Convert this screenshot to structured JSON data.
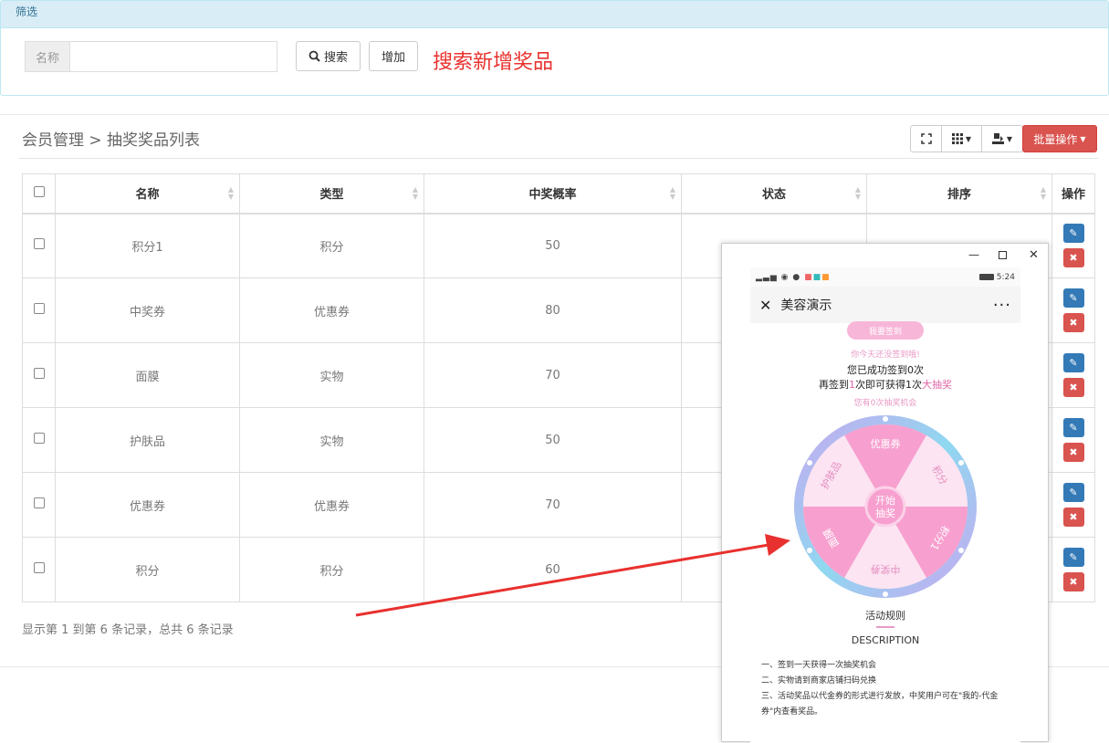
{
  "filter": {
    "header": "筛选",
    "name_label": "名称",
    "name_value": "",
    "search_label": "搜索",
    "add_label": "增加",
    "annotation": "搜索新增奖品"
  },
  "breadcrumb": "会员管理 > 抽奖奖品列表",
  "toolbar": {
    "batch_label": "批量操作"
  },
  "table": {
    "headers": [
      "名称",
      "类型",
      "中奖概率",
      "状态",
      "排序",
      "操作"
    ],
    "rows": [
      {
        "name": "积分1",
        "type": "积分",
        "prob": "50"
      },
      {
        "name": "中奖券",
        "type": "优惠券",
        "prob": "80"
      },
      {
        "name": "面膜",
        "type": "实物",
        "prob": "70"
      },
      {
        "name": "护肤品",
        "type": "实物",
        "prob": "50"
      },
      {
        "name": "优惠券",
        "type": "优惠券",
        "prob": "70"
      },
      {
        "name": "积分",
        "type": "积分",
        "prob": "60"
      }
    ],
    "footer": "显示第 1 到第 6 条记录，总共 6 条记录"
  },
  "colors": {
    "danger": "#d9534f",
    "primary": "#337ab7",
    "annotation": "#e8312e",
    "wheel_pink": "#f7a0cf"
  },
  "phone": {
    "time": "5:24",
    "title": "美容演示",
    "signin_button": "我要签到",
    "not_signed": "你今天还没签到哦!",
    "signed_count": "您已成功签到0次",
    "next_line_pre": "再签到",
    "next_line_num": "1",
    "next_line_mid": "次即可获得1次",
    "next_line_link": "大抽奖",
    "chances": "您有0次抽奖机会",
    "wheel_segments": [
      "优惠券",
      "积分",
      "积分1",
      "中奖券",
      "面膜",
      "护肤品"
    ],
    "start_label_1": "开始",
    "start_label_2": "抽奖",
    "rules_title": "活动规则",
    "description": "DESCRIPTION",
    "rule1": "一、签到一天获得一次抽奖机会",
    "rule2": "二、实物请到商家店铺扫码兑换",
    "rule3": "三、活动奖品以代金券的形式进行发放，中奖用户可在\"我的-代金券\"内查看奖品。"
  }
}
